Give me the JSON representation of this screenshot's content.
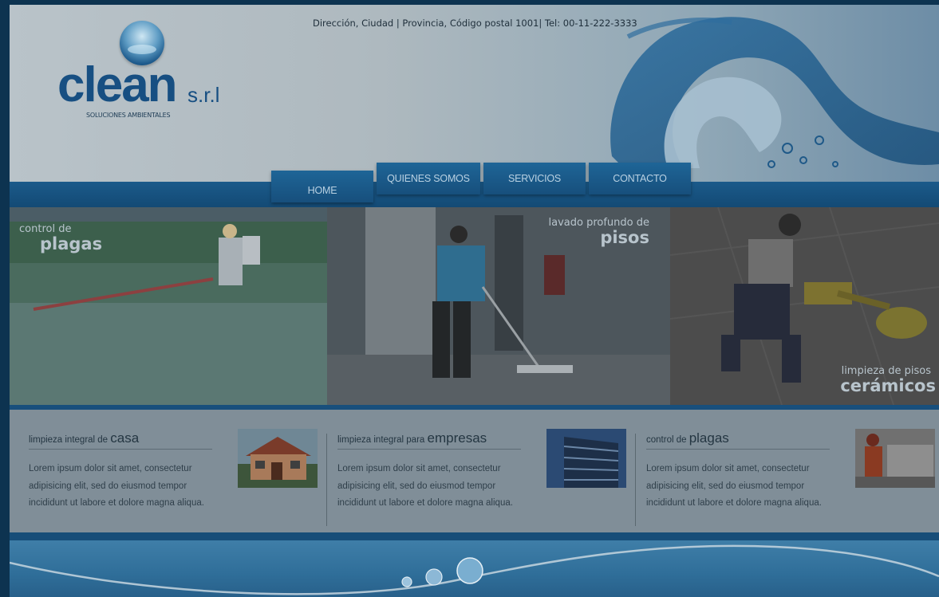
{
  "header": {
    "logo_word": "clean",
    "logo_suffix": "s.r.l",
    "logo_tagline": "SOLUCIONES AMBIENTALES",
    "contact_line": "Dirección, Ciudad | Provincia, Código postal 1001| Tel: 00-11-222-3333"
  },
  "nav": {
    "items": [
      {
        "label": "HOME"
      },
      {
        "label": "QUIENES SOMOS"
      },
      {
        "label": "SERVICIOS"
      },
      {
        "label": "CONTACTO"
      }
    ]
  },
  "banner": {
    "panels": [
      {
        "caption_small": "control de",
        "caption_big": "plagas"
      },
      {
        "caption_small": "lavado profundo de",
        "caption_big": "pisos"
      },
      {
        "caption_small": "limpieza de pisos",
        "caption_big": "cerámicos"
      }
    ]
  },
  "services": [
    {
      "title_prefix": "limpieza integral de ",
      "title_big": "casa",
      "text": "Lorem ipsum dolor sit amet, consectetur adipisicing elit, sed do eiusmod tempor incididunt ut labore et dolore magna aliqua."
    },
    {
      "title_prefix": "limpieza integral para ",
      "title_big": "empresas",
      "text": "Lorem ipsum dolor sit amet, consectetur adipisicing elit, sed do eiusmod tempor incididunt ut labore et dolore magna aliqua."
    },
    {
      "title_prefix": "control de ",
      "title_big": "plagas",
      "text": "Lorem ipsum dolor sit amet, consectetur adipisicing elit, sed do eiusmod tempor incididunt ut labore et dolore magna aliqua."
    }
  ],
  "colors": {
    "brand_blue": "#174f82",
    "nav_blue": "#1e6597",
    "overlay_dim": "#0d3350"
  }
}
